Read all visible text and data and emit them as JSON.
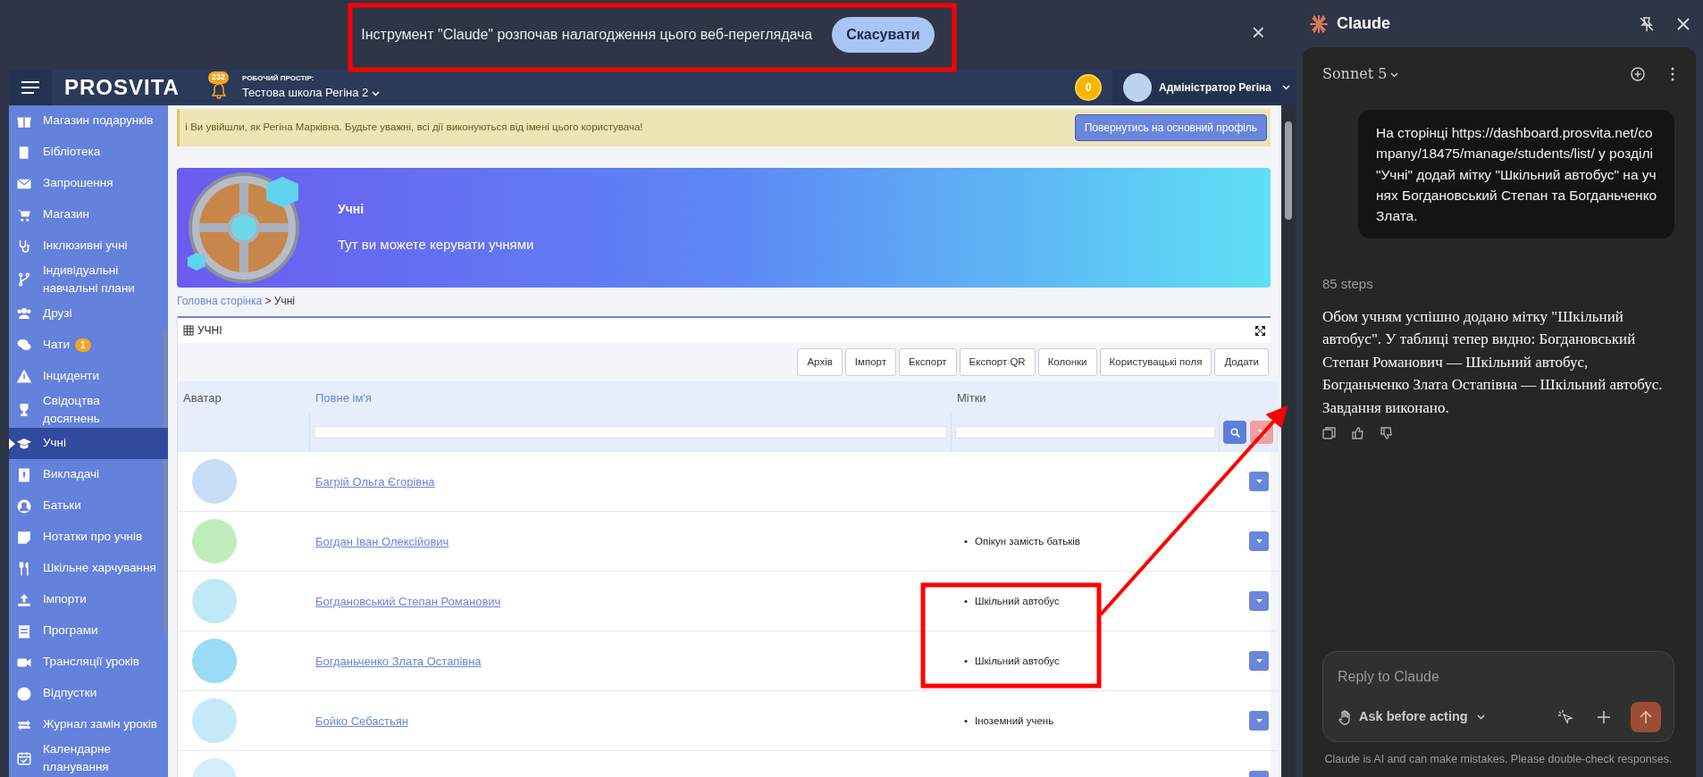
{
  "debug_bar": {
    "message": "Інструмент \"Claude\" розпочав налагодження цього веб-переглядача",
    "cancel_button": "Скасувати",
    "close": "×"
  },
  "navbar": {
    "logo": "PROSVITA",
    "notifications": "232",
    "workspace_label": "РОБОЧИЙ ПРОСТІР:",
    "workspace": "Тестова школа Регіна 2",
    "coins": "0",
    "user": "Адміністратор Регіна"
  },
  "sidebar": {
    "items": [
      {
        "label": "Магазин подарунків",
        "selected": false
      },
      {
        "label": "Бібліотека",
        "selected": false
      },
      {
        "label": "Запрошення",
        "selected": false
      },
      {
        "label": "Магазин",
        "selected": false
      },
      {
        "label": "Інклюзивні учні",
        "selected": false
      },
      {
        "label": "Індивідуальні навчальні плани",
        "selected": false
      },
      {
        "label": "Друзі",
        "selected": false
      },
      {
        "label": "Чати",
        "badge": "1",
        "selected": false
      },
      {
        "label": "Інциденти",
        "selected": false
      },
      {
        "label": "Свідоцтва досягнень",
        "selected": false
      },
      {
        "label": "Учні",
        "selected": true
      },
      {
        "label": "Викладачі",
        "selected": false
      },
      {
        "label": "Батьки",
        "selected": false
      },
      {
        "label": "Нотатки про учнів",
        "selected": false
      },
      {
        "label": "Шкільне харчування",
        "selected": false
      },
      {
        "label": "Імпорти",
        "selected": false
      },
      {
        "label": "Програми",
        "selected": false
      },
      {
        "label": "Трансляції уроків",
        "selected": false
      },
      {
        "label": "Відпустки",
        "selected": false
      },
      {
        "label": "Журнал замін уроків",
        "selected": false
      },
      {
        "label": "Календарне планування",
        "selected": false
      }
    ]
  },
  "alert": {
    "icon": "ℹ",
    "text": "Ви увійшли, як Регіна Марківна. Будьте уважні, всі дії виконуються від імені цього користувача!",
    "button": "Повернутись на основний профіль"
  },
  "banner": {
    "title": "Учні",
    "subtitle": "Тут ви можете керувати учнями"
  },
  "breadcrumb": {
    "home": "Головна сторінка",
    "current": "> Учні"
  },
  "table": {
    "title": "УЧНІ",
    "bullet": "•",
    "toolbar": [
      "Архів",
      "Імпорт",
      "Експорт",
      "Експорт QR",
      "Колонки",
      "Користувацькі поля",
      "Додати"
    ],
    "columns": [
      "Аватар",
      "Повне ім'я",
      "Мітки"
    ],
    "rows": [
      {
        "color": "#c9dcf7",
        "name": "Багрій Ольга Єгорівна",
        "tags": []
      },
      {
        "color": "#bfeebc",
        "name": "Богдан Іван Олексійович",
        "tags": [
          "Опікун замість батьків"
        ]
      },
      {
        "color": "#bfe9f7",
        "name": "Богдановський Степан Романович",
        "tags": [
          "Шкільний автобус"
        ]
      },
      {
        "color": "#9adcf5",
        "name": "Богданьченко Злата Остапівна",
        "tags": [
          "Шкільний автобус"
        ]
      },
      {
        "color": "#c4e9f8",
        "name": "Бойко Себастьян",
        "tags": [
          "Іноземний учень"
        ]
      },
      {
        "color": "#d5eefc",
        "tags": []
      }
    ]
  },
  "assistant": {
    "title": "Claude",
    "model": "Sonnet 5",
    "user_message": "На сторінці https://dashboard.prosvita.net/company/18475/manage/students/list/ у розділі \"Учні\" додай мітку \"Шкільний автобус\" на учнях Богдановський Степан та Богданьченко Злата.",
    "steps": "85 steps",
    "reply": "Обом учням успішно додано мітку \"Шкільний автобус\". У таблиці тепер видно: Богдановський Степан Романович — Шкільний автобус, Богданьченко Злата Остапівна — Шкільний автобус. Завдання виконано.",
    "input_placeholder": "Reply to Claude",
    "mode": "Ask before acting",
    "disclaimer": "Claude is AI and can make mistakes. Please double-check responses."
  }
}
